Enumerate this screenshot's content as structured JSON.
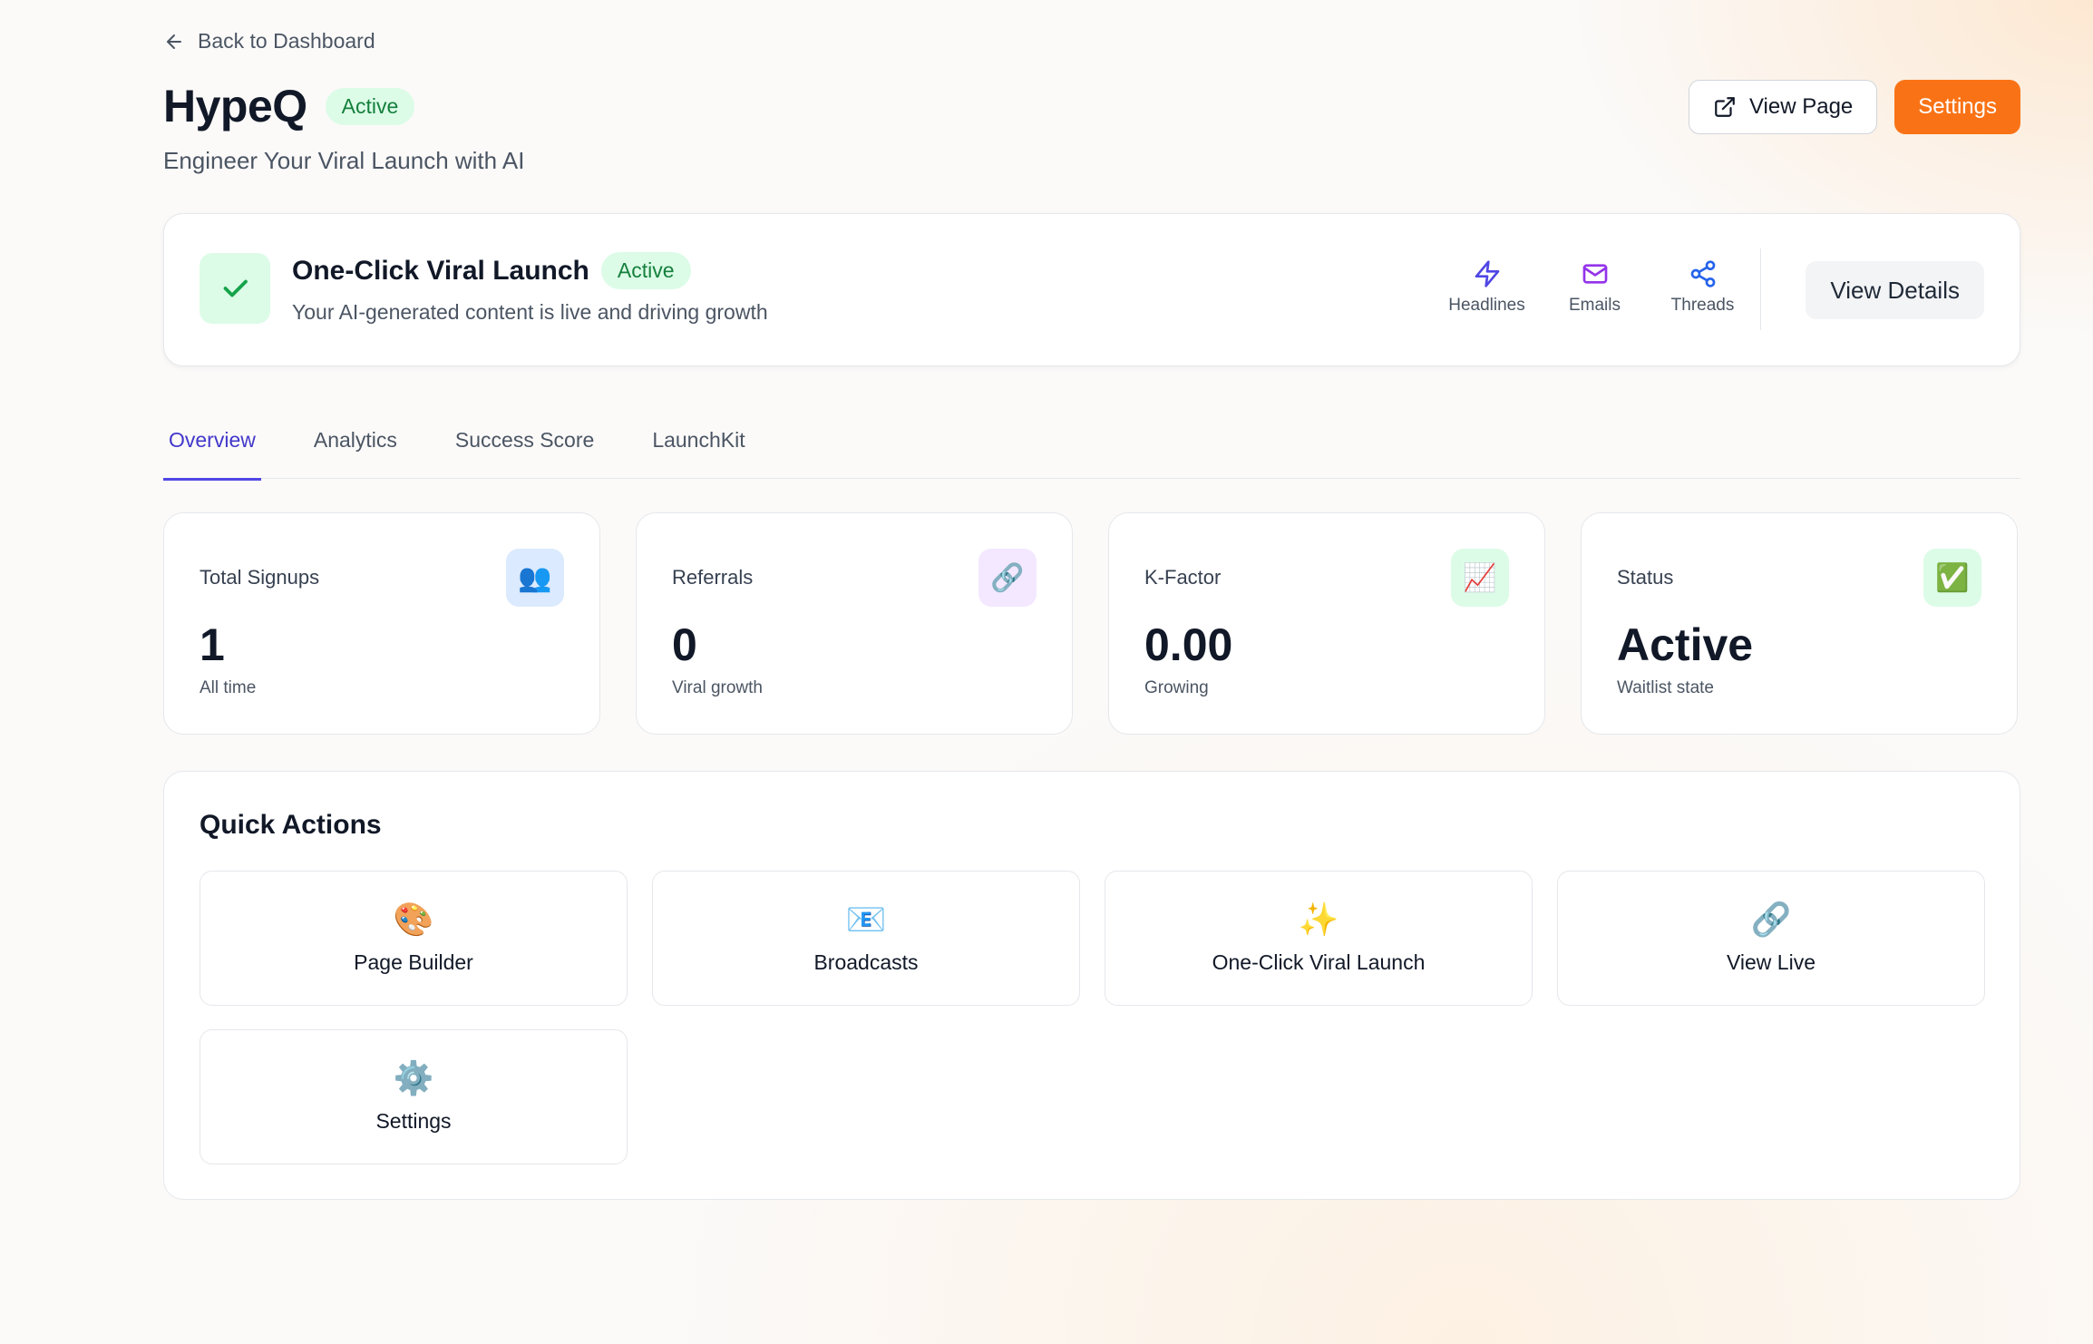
{
  "back_link": "Back to Dashboard",
  "project": {
    "name": "HypeQ",
    "status": "Active",
    "tagline": "Engineer Your Viral Launch with AI"
  },
  "header_actions": {
    "view_page": "View Page",
    "settings": "Settings"
  },
  "launch": {
    "title": "One-Click Viral Launch",
    "status": "Active",
    "description": "Your AI-generated content is live and driving growth",
    "icons": [
      {
        "label": "Headlines",
        "icon": "lightning-icon"
      },
      {
        "label": "Emails",
        "icon": "mail-icon"
      },
      {
        "label": "Threads",
        "icon": "share-icon"
      }
    ],
    "details_button": "View Details"
  },
  "tabs": [
    {
      "label": "Overview",
      "active": true
    },
    {
      "label": "Analytics",
      "active": false
    },
    {
      "label": "Success Score",
      "active": false
    },
    {
      "label": "LaunchKit",
      "active": false
    }
  ],
  "stats": [
    {
      "label": "Total Signups",
      "value": "1",
      "note": "All time",
      "icon": "👥",
      "icon_bg": "#dbeafe"
    },
    {
      "label": "Referrals",
      "value": "0",
      "note": "Viral growth",
      "icon": "🔗",
      "icon_bg": "#f3e8ff"
    },
    {
      "label": "K-Factor",
      "value": "0.00",
      "note": "Growing",
      "icon": "📈",
      "icon_bg": "#dcfce7"
    },
    {
      "label": "Status",
      "value": "Active",
      "note": "Waitlist state",
      "icon": "✅",
      "icon_bg": "#dcfce7"
    }
  ],
  "quick_actions": {
    "title": "Quick Actions",
    "items": [
      {
        "label": "Page Builder",
        "icon": "🎨"
      },
      {
        "label": "Broadcasts",
        "icon": "📧"
      },
      {
        "label": "One-Click Viral Launch",
        "icon": "✨"
      },
      {
        "label": "View Live",
        "icon": "🔗"
      },
      {
        "label": "Settings",
        "icon": "⚙️"
      }
    ]
  },
  "colors": {
    "accent": "#f97316",
    "tab_active": "#4f46e5",
    "success_bg": "#dcfce7",
    "success_text": "#15803d"
  }
}
